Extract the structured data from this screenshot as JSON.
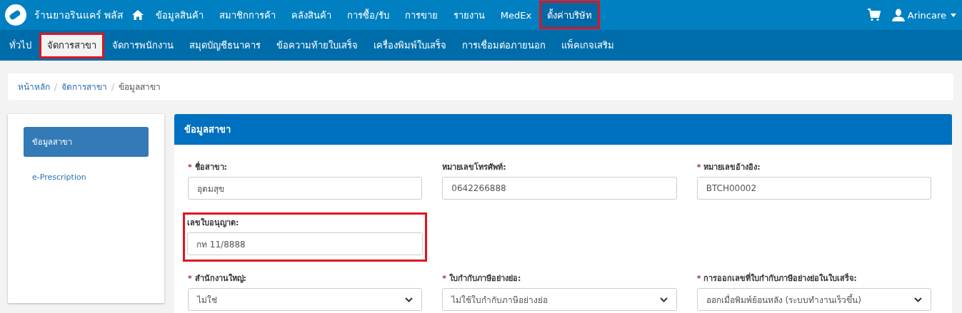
{
  "brand": {
    "name": "ร้านยาอรินแคร์ พลัส"
  },
  "nav": [
    {
      "label": "ข้อมูลสินค้า",
      "highlighted": false
    },
    {
      "label": "สมาชิกการค้า",
      "highlighted": false
    },
    {
      "label": "คลังสินค้า",
      "highlighted": false
    },
    {
      "label": "การซื้อ/รับ",
      "highlighted": false
    },
    {
      "label": "การขาย",
      "highlighted": false
    },
    {
      "label": "รายงาน",
      "highlighted": false
    },
    {
      "label": "MedEx",
      "highlighted": false
    },
    {
      "label": "ตั้งค่าบริษัท",
      "highlighted": true
    }
  ],
  "user": {
    "name": "Arincare"
  },
  "subnav": [
    {
      "label": "ทั่วไป",
      "selected": false,
      "highlighted": false
    },
    {
      "label": "จัดการสาขา",
      "selected": true,
      "highlighted": true
    },
    {
      "label": "จัดการพนักงาน",
      "selected": false,
      "highlighted": false
    },
    {
      "label": "สมุดบัญชีธนาคาร",
      "selected": false,
      "highlighted": false
    },
    {
      "label": "ข้อความท้ายใบเสร็จ",
      "selected": false,
      "highlighted": false
    },
    {
      "label": "เครื่องพิมพ์ใบเสร็จ",
      "selected": false,
      "highlighted": false
    },
    {
      "label": "การเชื่อมต่อภายนอก",
      "selected": false,
      "highlighted": false
    },
    {
      "label": "แพ็คเกจเสริม",
      "selected": false,
      "highlighted": false
    }
  ],
  "breadcrumb": [
    {
      "label": "หน้าหลัก",
      "kind": "link"
    },
    {
      "separator": "/",
      "label": "จัดการสาขา",
      "kind": "link"
    },
    {
      "separator": "/",
      "label": "ข้อมูลสาขา",
      "kind": "current"
    }
  ],
  "sidebar": {
    "items": [
      {
        "label": "ข้อมูลสาขา",
        "selected": true
      },
      {
        "label": "e-Prescription",
        "selected": false
      }
    ]
  },
  "panel": {
    "title": "ข้อมูลสาขา",
    "required_mark": "*",
    "rows": [
      [
        {
          "label": "ชื่อสาขา:",
          "required": true,
          "kind": "input",
          "value": "อุดมสุข",
          "highlighted": false
        },
        {
          "label": "หมายเลขโทรศัพท์:",
          "required": false,
          "kind": "input",
          "value": "0642266888",
          "highlighted": false
        },
        {
          "label": "หมายเลขอ้างอิง:",
          "required": true,
          "kind": "input",
          "value": "BTCH00002",
          "highlighted": false
        }
      ],
      [
        {
          "label": "เลขใบอนุญาต:",
          "required": false,
          "kind": "input",
          "value": "กท 11/8888",
          "highlighted": true
        }
      ],
      [
        {
          "label": "สำนักงานใหญ่:",
          "required": true,
          "kind": "select",
          "value": "ไม่ใช่",
          "highlighted": false
        },
        {
          "label": "ใบกำกับภาษีอย่างย่อ:",
          "required": true,
          "kind": "select",
          "value": "ไม่ใช้ใบกำกับภาษีอย่างย่อ",
          "highlighted": false
        },
        {
          "label": "การออกเลขที่ใบกำกับภาษีอย่างย่อในใบเสร็จ:",
          "required": true,
          "kind": "select",
          "value": "ออกเมื่อพิมพ์ย้อนหลัง (ระบบทำงานเร็วขึ้น)",
          "highlighted": false
        }
      ]
    ]
  }
}
